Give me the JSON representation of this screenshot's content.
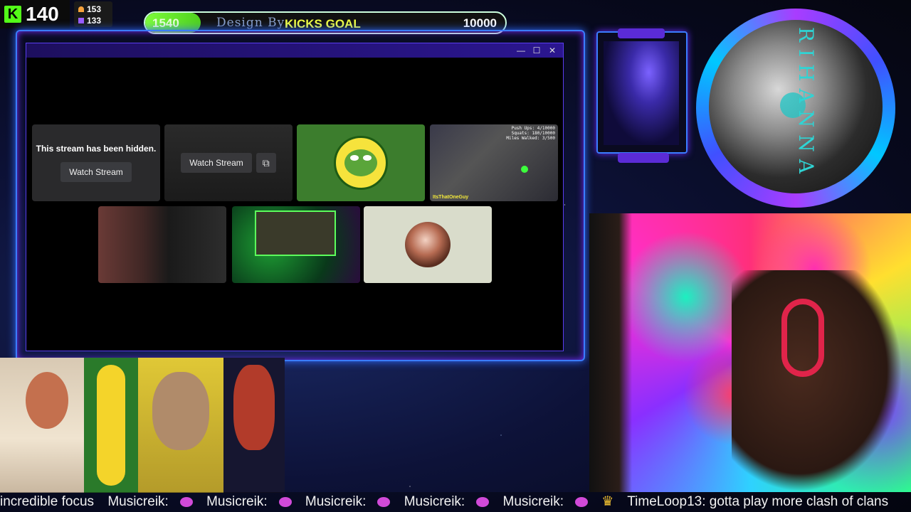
{
  "kick": {
    "logo": "K",
    "viewers": "140"
  },
  "stats": {
    "followers": "153",
    "subs": "133"
  },
  "goal": {
    "current": "1540",
    "credit": "Design By:",
    "title": "KICKS GOAL",
    "target": "10000",
    "progress_fraction": 0.154
  },
  "window": {
    "controls": {
      "minimize": "—",
      "maximize": "☐",
      "close": "✕"
    },
    "tiles": {
      "hidden_message": "This stream has been hidden.",
      "hidden_button": "Watch Stream",
      "watch_button": "Watch Stream",
      "popout_icon": "⧉",
      "game_hud": "Push Ups: 4/10000\nSquats: 180/10000\nMiles Walked: 3/500",
      "game_tag": "ItsThatOneGuy"
    }
  },
  "album": {
    "text": "RIHANNA"
  },
  "ticker": {
    "messages": [
      "incredible focus",
      "Musicreik:",
      "Musicreik:",
      "Musicreik:",
      "Musicreik:",
      "Musicreik:",
      "TimeLoop13: gotta play more clash of clans"
    ],
    "crown": "♛"
  },
  "colors": {
    "kick_green": "#53fc18",
    "goal_yellow": "#f2ff40",
    "frame_blue": "#3b7dff",
    "window_purple": "#2b1690"
  }
}
